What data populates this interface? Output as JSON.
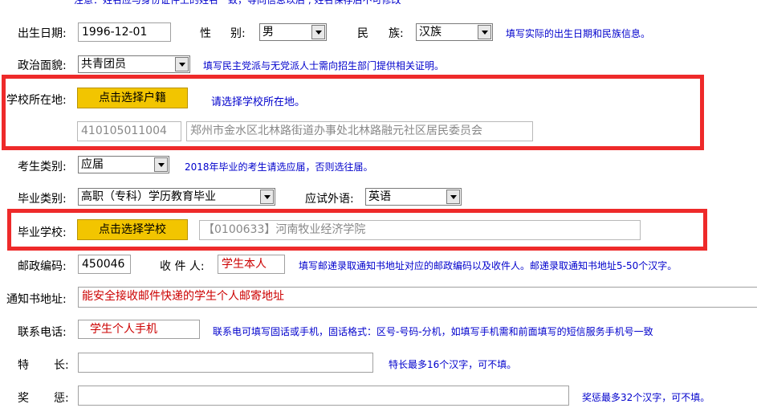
{
  "top_hint": "注意：姓名应与身份证件上的姓名一致，等同信息以后 , 姓名保存后不可修改",
  "birth": {
    "label": "出生日期:",
    "value": "1996-12-01"
  },
  "gender": {
    "label1": "性",
    "label2": "别:",
    "value": "男"
  },
  "ethnic": {
    "label1": "民",
    "label2": "族:",
    "value": "汉族",
    "hint": "填写实际的出生日期和民族信息。"
  },
  "political": {
    "label": "政治面貌:",
    "value": "共青团员",
    "hint": "填写民主党派与无党派人士需向招生部门提供相关证明。"
  },
  "school_location": {
    "label": "学校所在地:",
    "button": "点击选择户籍",
    "hint": "请选择学校所在地。",
    "code": "410105011004",
    "address": "郑州市金水区北林路街道办事处北林路融元社区居民委员会"
  },
  "candidate_type": {
    "label": "考生类别:",
    "value": "应届",
    "hint": "2018年毕业的考生请选应届，否则选往届。"
  },
  "grad_type": {
    "label": "毕业类别:",
    "value": "高职（专科）学历教育毕业"
  },
  "language": {
    "label": "应试外语:",
    "value": "英语"
  },
  "grad_school": {
    "label": "毕业学校:",
    "button": "点击选择学校",
    "value": "【0100633】河南牧业经济学院"
  },
  "postcode": {
    "label": "邮政编码:",
    "value": "450046"
  },
  "recipient": {
    "label": "收 件 人:",
    "value": "学生本人",
    "hint": "填写邮递录取通知书地址对应的邮政编码以及收件人。邮递录取通知书地址5-50个汉字。"
  },
  "address": {
    "label": "通知书地址:",
    "value": "能安全接收邮件快递的学生个人邮寄地址"
  },
  "phone": {
    "label": "联系电话:",
    "value": "学生个人手机",
    "hint": "联系电可填写固话或手机，固话格式：区号-号码-分机，如填写手机需和前面填写的短信服务手机号一致"
  },
  "specialty": {
    "label1": "特",
    "label2": "长:",
    "hint": "特长最多16个汉字，可不填。"
  },
  "awards": {
    "label1": "奖",
    "label2": "惩:",
    "hint": "奖惩最多32个汉字，可不填。"
  }
}
